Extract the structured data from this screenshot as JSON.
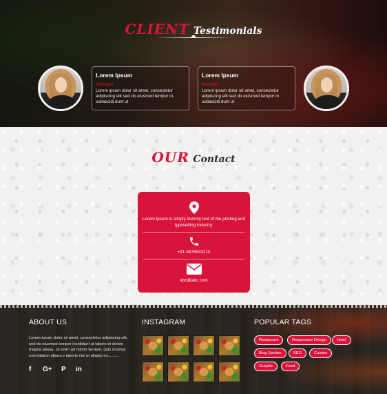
{
  "testimonials": {
    "title_accent": "CLIENT",
    "title_rest": "Testimonials",
    "cards": [
      {
        "name": "Lorem Ipsum",
        "role": "Manager",
        "text": "Lorem ipsum dolor sit amet, consectetur adipiscing elit sed do eiusmod tempor in subascidi dunt ut"
      },
      {
        "name": "Lorem Ipsum",
        "role": "Manager",
        "text": "Lorem ipsum dolor sit amet, consectetur adipiscing elit sed do eiusmod tempor in subascidi dunt ut"
      }
    ]
  },
  "contact": {
    "title_accent": "OUR",
    "title_rest": "Contact",
    "address": "Lorem Ipsum is simply dummy text of the printing and typesetting industry.",
    "phone": "+91-9876543210",
    "email": "abc@abc.com",
    "icons": [
      "map-pin-icon",
      "phone-icon",
      "envelope-icon"
    ]
  },
  "footer": {
    "about": {
      "heading": "ABOUT US",
      "text": "Lorem ipsum dolor sit amet, consectetur adipiscing elit, sed do eiusmod tempor incididunt ut labore et dolore magna aliqua. Ut enim ad minim veniam, quis nostrud exercitation ullamco laboris nisi ut aliquip ex.........",
      "social": [
        "f",
        "G+",
        "P",
        "in"
      ]
    },
    "instagram": {
      "heading": "INSTAGRAM"
    },
    "tags": {
      "heading": "POPULAR TAGS",
      "items": [
        "Restaurant",
        "Responsive Design",
        "Hotel",
        "Blog Section",
        "SEO",
        "Cuisine",
        "Graphic",
        "Food"
      ]
    }
  },
  "colors": {
    "accent": "#d8143a",
    "footer_bg": "#2a2420"
  }
}
